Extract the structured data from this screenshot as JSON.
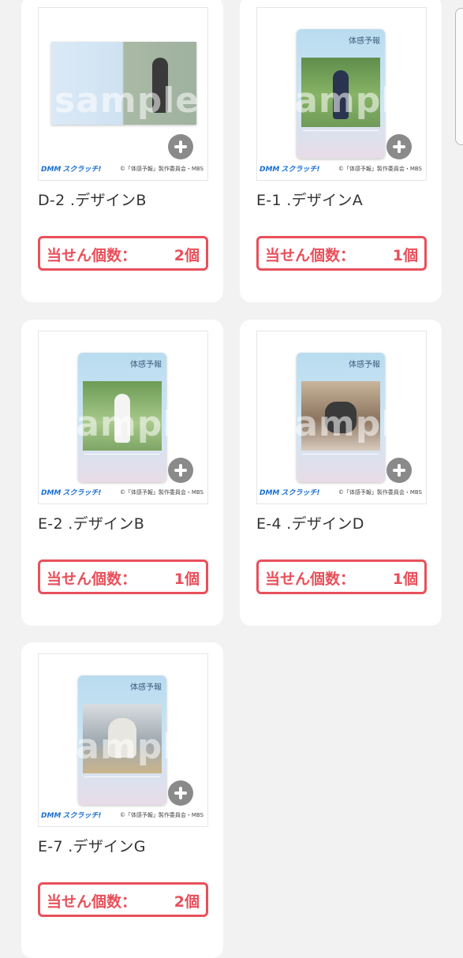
{
  "watermark": "sample",
  "brand": {
    "prefix": "DMM",
    "name": "スクラッチ!"
  },
  "copyright": "©「体感予報」製作委員会・MBS",
  "card_logo": "体感予報",
  "count_label": "当せん個数：",
  "items": [
    {
      "title": "D-2 .デザインB",
      "count": "2個"
    },
    {
      "title": "E-1 .デザインA",
      "count": "1個"
    },
    {
      "title": "E-2 .デザインB",
      "count": "1個"
    },
    {
      "title": "E-4 .デザインD",
      "count": "1個"
    },
    {
      "title": "E-7 .デザインG",
      "count": "2個"
    }
  ]
}
